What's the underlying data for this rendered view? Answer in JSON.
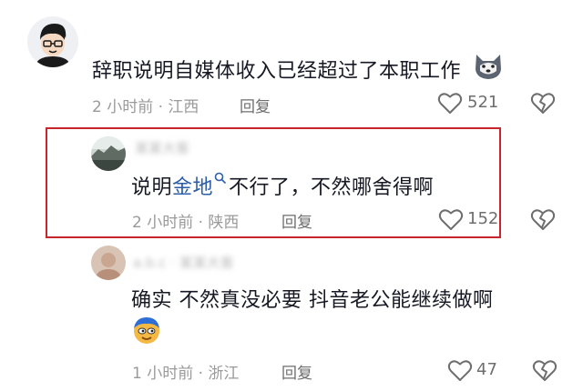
{
  "comments": [
    {
      "text": "辞职说明自媒体收入已经超过了本职工作",
      "meta": "2 小时前 · 江西",
      "reply_label": "回复",
      "like_count": "521",
      "emoji_icon": "husky-dog-icon"
    },
    {
      "username": "某某大客",
      "text_prefix": "说明",
      "text_link": "金地",
      "text_suffix": "不行了，不然哪舍得啊",
      "meta": "2 小时前 · 陕西",
      "reply_label": "回复",
      "like_count": "152"
    },
    {
      "username": "a.b.c · 某某大客",
      "text": "确实  不然真没必要  抖音老公能继续做啊",
      "meta": "1 小时前 · 浙江",
      "reply_label": "回复",
      "like_count": "47",
      "emoji_icon": "doge-emoji-icon"
    }
  ],
  "colors": {
    "highlight": "#c8242b",
    "link": "#2c5ea8",
    "meta": "#9a9a9a"
  }
}
